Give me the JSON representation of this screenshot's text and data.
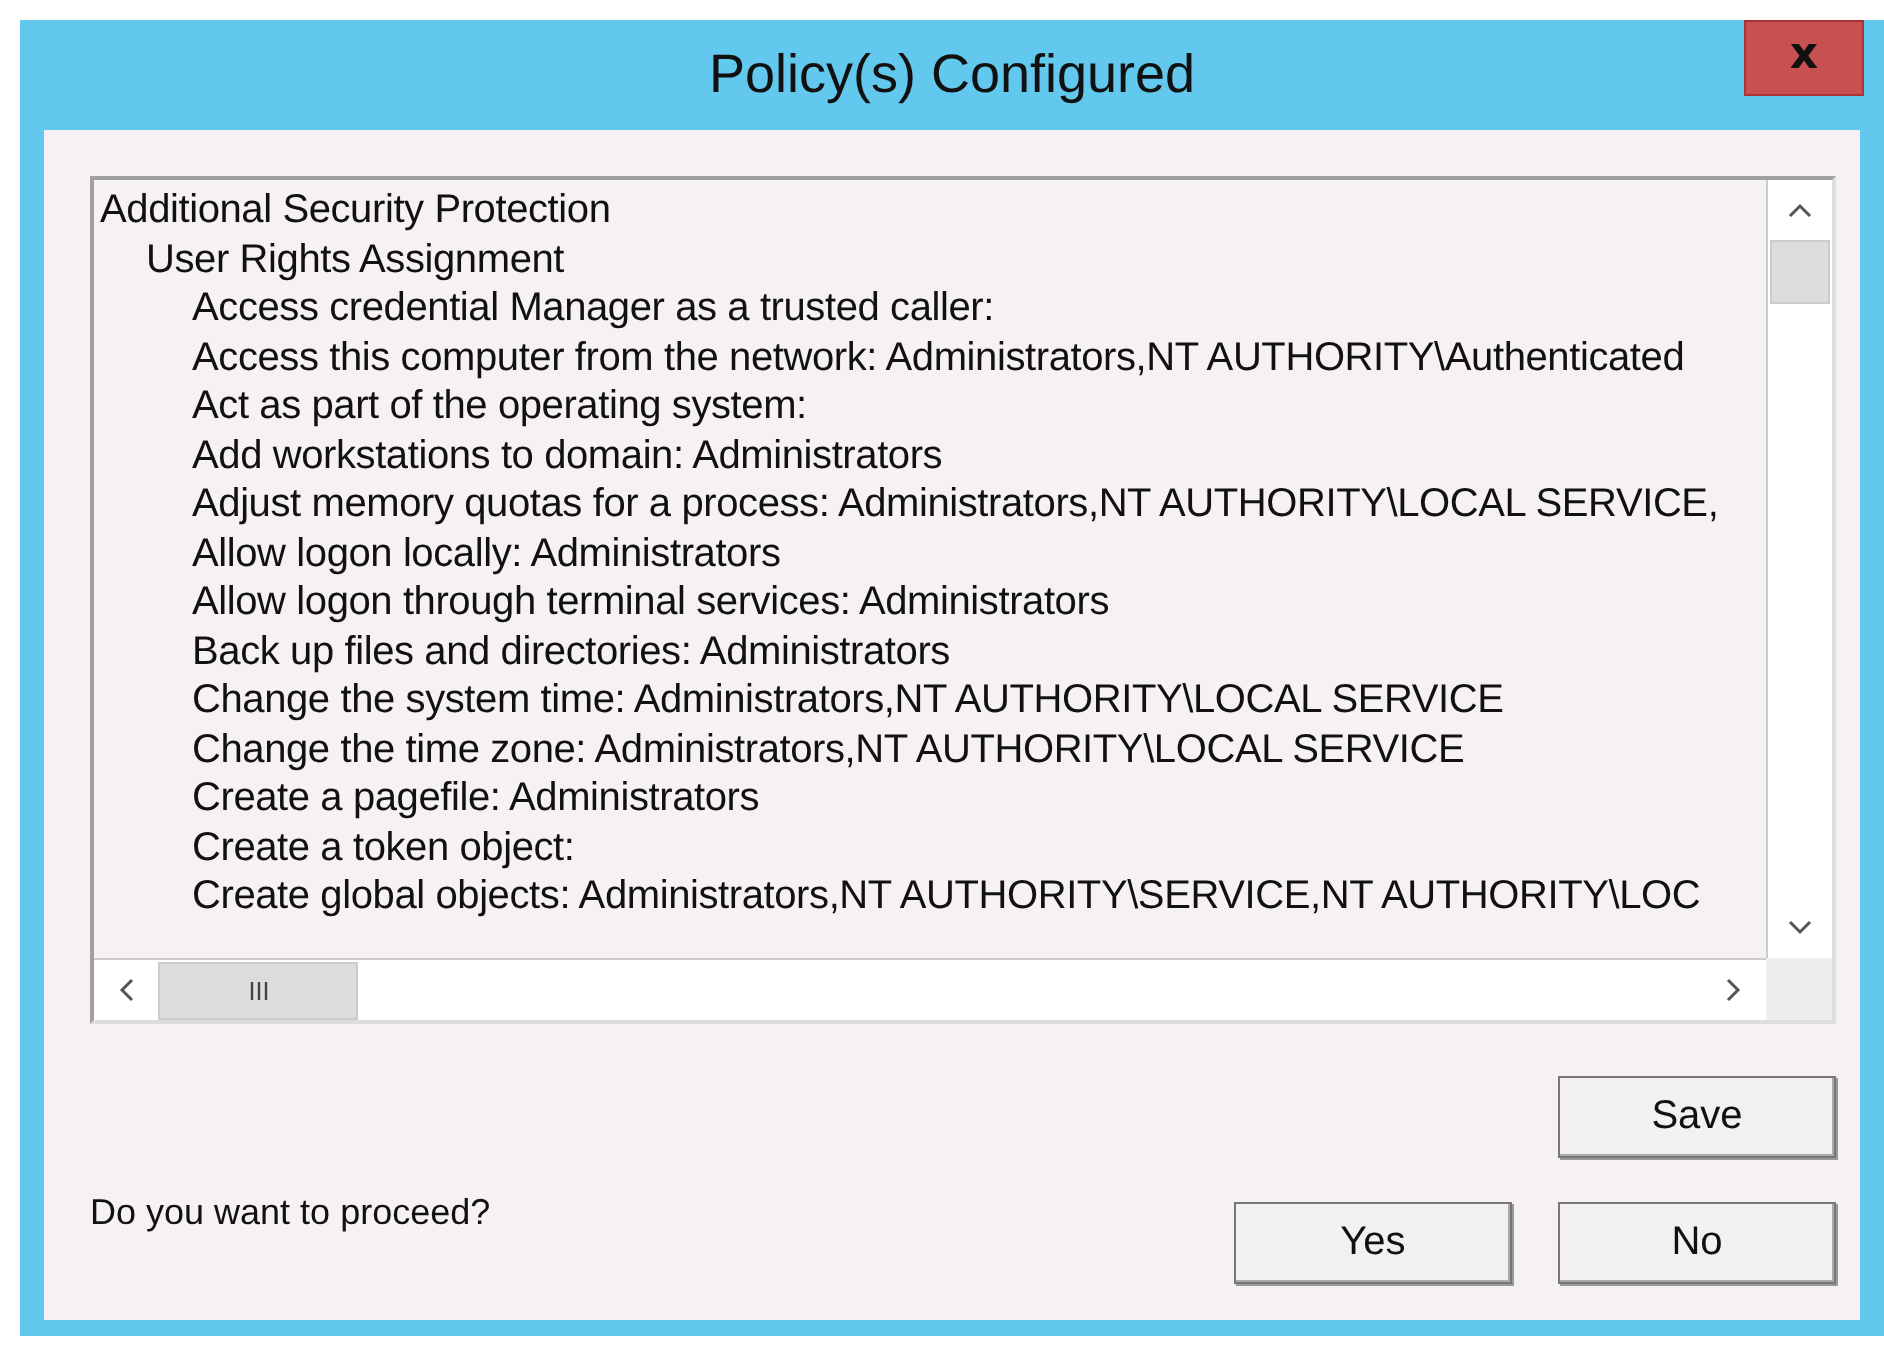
{
  "window": {
    "title": "Policy(s) Configured",
    "close": "x"
  },
  "tree": [
    {
      "label": "Additional Security Protection",
      "children": [
        {
          "label": "User Rights Assignment",
          "children": [
            {
              "label": "Access credential Manager as a trusted caller:"
            },
            {
              "label": "Access this computer from the network: Administrators,NT AUTHORITY\\Authenticated"
            },
            {
              "label": "Act as part of the operating system:"
            },
            {
              "label": "Add workstations to domain: Administrators"
            },
            {
              "label": "Adjust memory quotas for a process: Administrators,NT AUTHORITY\\LOCAL SERVICE,"
            },
            {
              "label": "Allow logon locally: Administrators"
            },
            {
              "label": "Allow logon through terminal services: Administrators"
            },
            {
              "label": "Back up files and directories: Administrators"
            },
            {
              "label": "Change the system time: Administrators,NT AUTHORITY\\LOCAL SERVICE"
            },
            {
              "label": "Change the time zone: Administrators,NT AUTHORITY\\LOCAL SERVICE"
            },
            {
              "label": "Create a pagefile: Administrators"
            },
            {
              "label": "Create a token object:"
            },
            {
              "label": "Create global objects: Administrators,NT AUTHORITY\\SERVICE,NT AUTHORITY\\LOC"
            }
          ]
        }
      ]
    }
  ],
  "buttons": {
    "save": "Save",
    "yes": "Yes",
    "no": "No"
  },
  "question": "Do you want to proceed?"
}
